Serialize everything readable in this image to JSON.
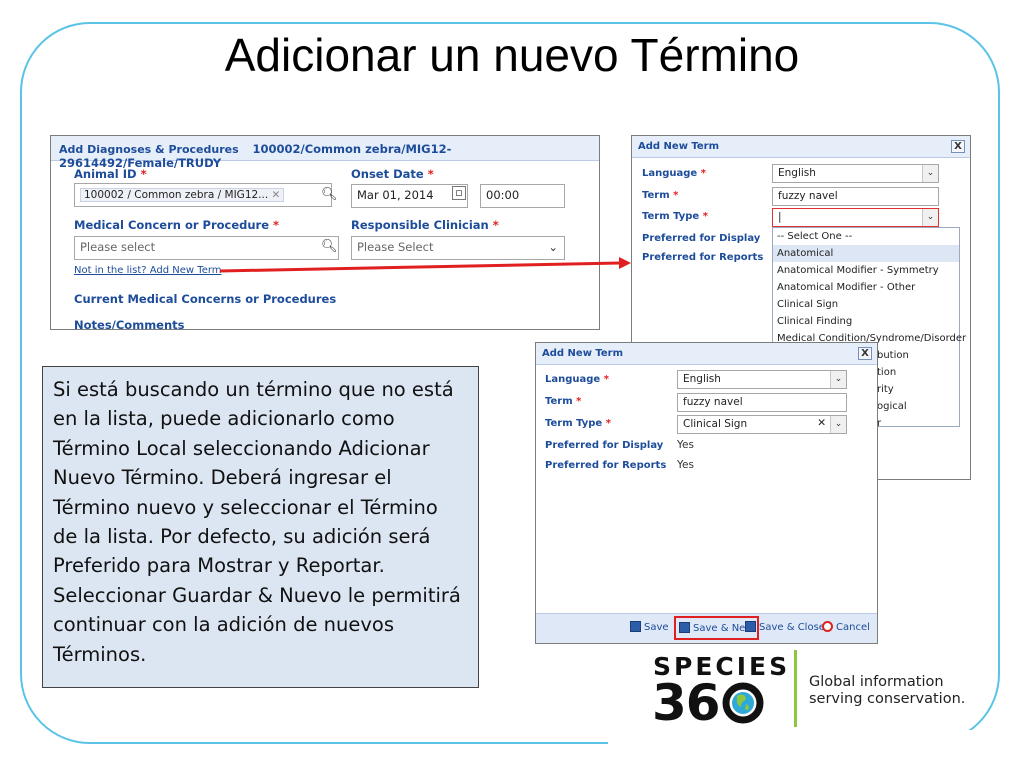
{
  "title": "Adicionar un nuevo Término",
  "form": {
    "header_title": "Add Diagnoses & Procedures",
    "header_context": "100002/Common zebra/MIG12-29614492/Female/TRUDY",
    "animal_id_label": "Animal ID",
    "animal_id_value": "100002 / Common zebra / MIG12...",
    "onset_date_label": "Onset Date",
    "onset_date_value": "Mar 01, 2014",
    "onset_time_value": "00:00",
    "medical_concern_label": "Medical Concern or Procedure",
    "medical_concern_placeholder": "Please select",
    "clinician_label": "Responsible Clinician",
    "clinician_placeholder": "Please Select",
    "add_term_link": "Not in the list? Add New Term",
    "current_section": "Current Medical Concerns or Procedures",
    "notes_section": "Notes/Comments",
    "required_mark": "*"
  },
  "dialog_top": {
    "title": "Add New Term",
    "close": "X",
    "language_label": "Language",
    "language_value": "English",
    "term_label": "Term",
    "term_value": "fuzzy navel",
    "term_type_label": "Term Type",
    "term_type_value": "|",
    "pref_display_label": "Preferred for Display",
    "pref_reports_label": "Preferred for Reports",
    "dropdown_items": [
      "-- Select One --",
      "Anatomical",
      "Anatomical Modifier - Symmetry",
      "Anatomical Modifier - Other",
      "Clinical Sign",
      "Clinical Finding",
      "Medical Condition/Syndrome/Disorder",
      "bution",
      "tion",
      "rity",
      "ogical",
      "r"
    ]
  },
  "dialog_bottom": {
    "title": "Add New Term",
    "close": "X",
    "language_label": "Language",
    "language_value": "English",
    "term_label": "Term",
    "term_value": "fuzzy navel",
    "term_type_label": "Term Type",
    "term_type_value": "Clinical Sign",
    "pref_display_label": "Preferred for Display",
    "pref_display_value": "Yes",
    "pref_reports_label": "Preferred for Reports",
    "pref_reports_value": "Yes",
    "btn_save": "Save",
    "btn_save_new": "Save & New",
    "btn_save_close": "Save & Close",
    "btn_cancel": "Cancel"
  },
  "description": "Si está buscando un término que no está en la lista, puede adicionarlo como Término Local seleccionando  Adicionar Nuevo Término. Deberá ingresar el Término nuevo y seleccionar el Término de la lista.  Por defecto, su adición será Preferido para Mostrar y Reportar. Seleccionar Guardar & Nuevo le permitirá continuar con la adición de nuevos Términos.",
  "logo": {
    "species": "SPECIES",
    "number": "360",
    "tagline_line1": "Global information",
    "tagline_line2": "serving conservation."
  },
  "colors": {
    "frame": "#5bc4e6",
    "header_text": "#1d4c9a",
    "arrow": "#e02020",
    "note_bg": "#dce6f2",
    "logo_green": "#8fc640"
  }
}
